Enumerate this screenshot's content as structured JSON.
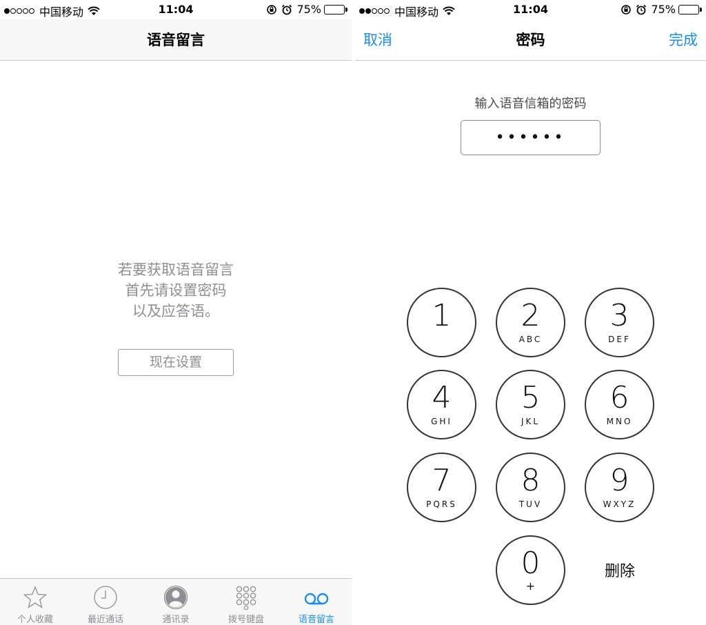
{
  "left": {
    "status": {
      "carrier": "中国移动",
      "time": "11:04",
      "battery": "75%",
      "battery_level": 0.75
    },
    "nav": {
      "title": "语音留言"
    },
    "message_lines": [
      "若要获取语音留言",
      "首先请设置密码",
      "以及应答语。"
    ],
    "setup_button": "现在设置",
    "tabs": [
      {
        "label": "个人收藏",
        "icon": "star-icon",
        "active": false
      },
      {
        "label": "最近通话",
        "icon": "clock-icon",
        "active": false
      },
      {
        "label": "通讯录",
        "icon": "contacts-icon",
        "active": false
      },
      {
        "label": "拨号键盘",
        "icon": "keypad-icon",
        "active": false
      },
      {
        "label": "语音留言",
        "icon": "voicemail-icon",
        "active": true
      }
    ]
  },
  "right": {
    "status": {
      "carrier": "中国移动",
      "time": "11:04",
      "battery": "75%",
      "battery_level": 0.75
    },
    "nav": {
      "cancel": "取消",
      "title": "密码",
      "done": "完成"
    },
    "prompt": "输入语音信箱的密码",
    "password_mask": "••••••",
    "keys": [
      {
        "digit": "1",
        "letters": ""
      },
      {
        "digit": "2",
        "letters": "ABC"
      },
      {
        "digit": "3",
        "letters": "DEF"
      },
      {
        "digit": "4",
        "letters": "GHI"
      },
      {
        "digit": "5",
        "letters": "JKL"
      },
      {
        "digit": "6",
        "letters": "MNO"
      },
      {
        "digit": "7",
        "letters": "PQRS"
      },
      {
        "digit": "8",
        "letters": "TUV"
      },
      {
        "digit": "9",
        "letters": "WXYZ"
      },
      {
        "digit": "0",
        "letters": "+"
      }
    ],
    "delete_label": "删除"
  },
  "colors": {
    "accent": "#1a8cf0",
    "muted": "#8e8e93"
  }
}
